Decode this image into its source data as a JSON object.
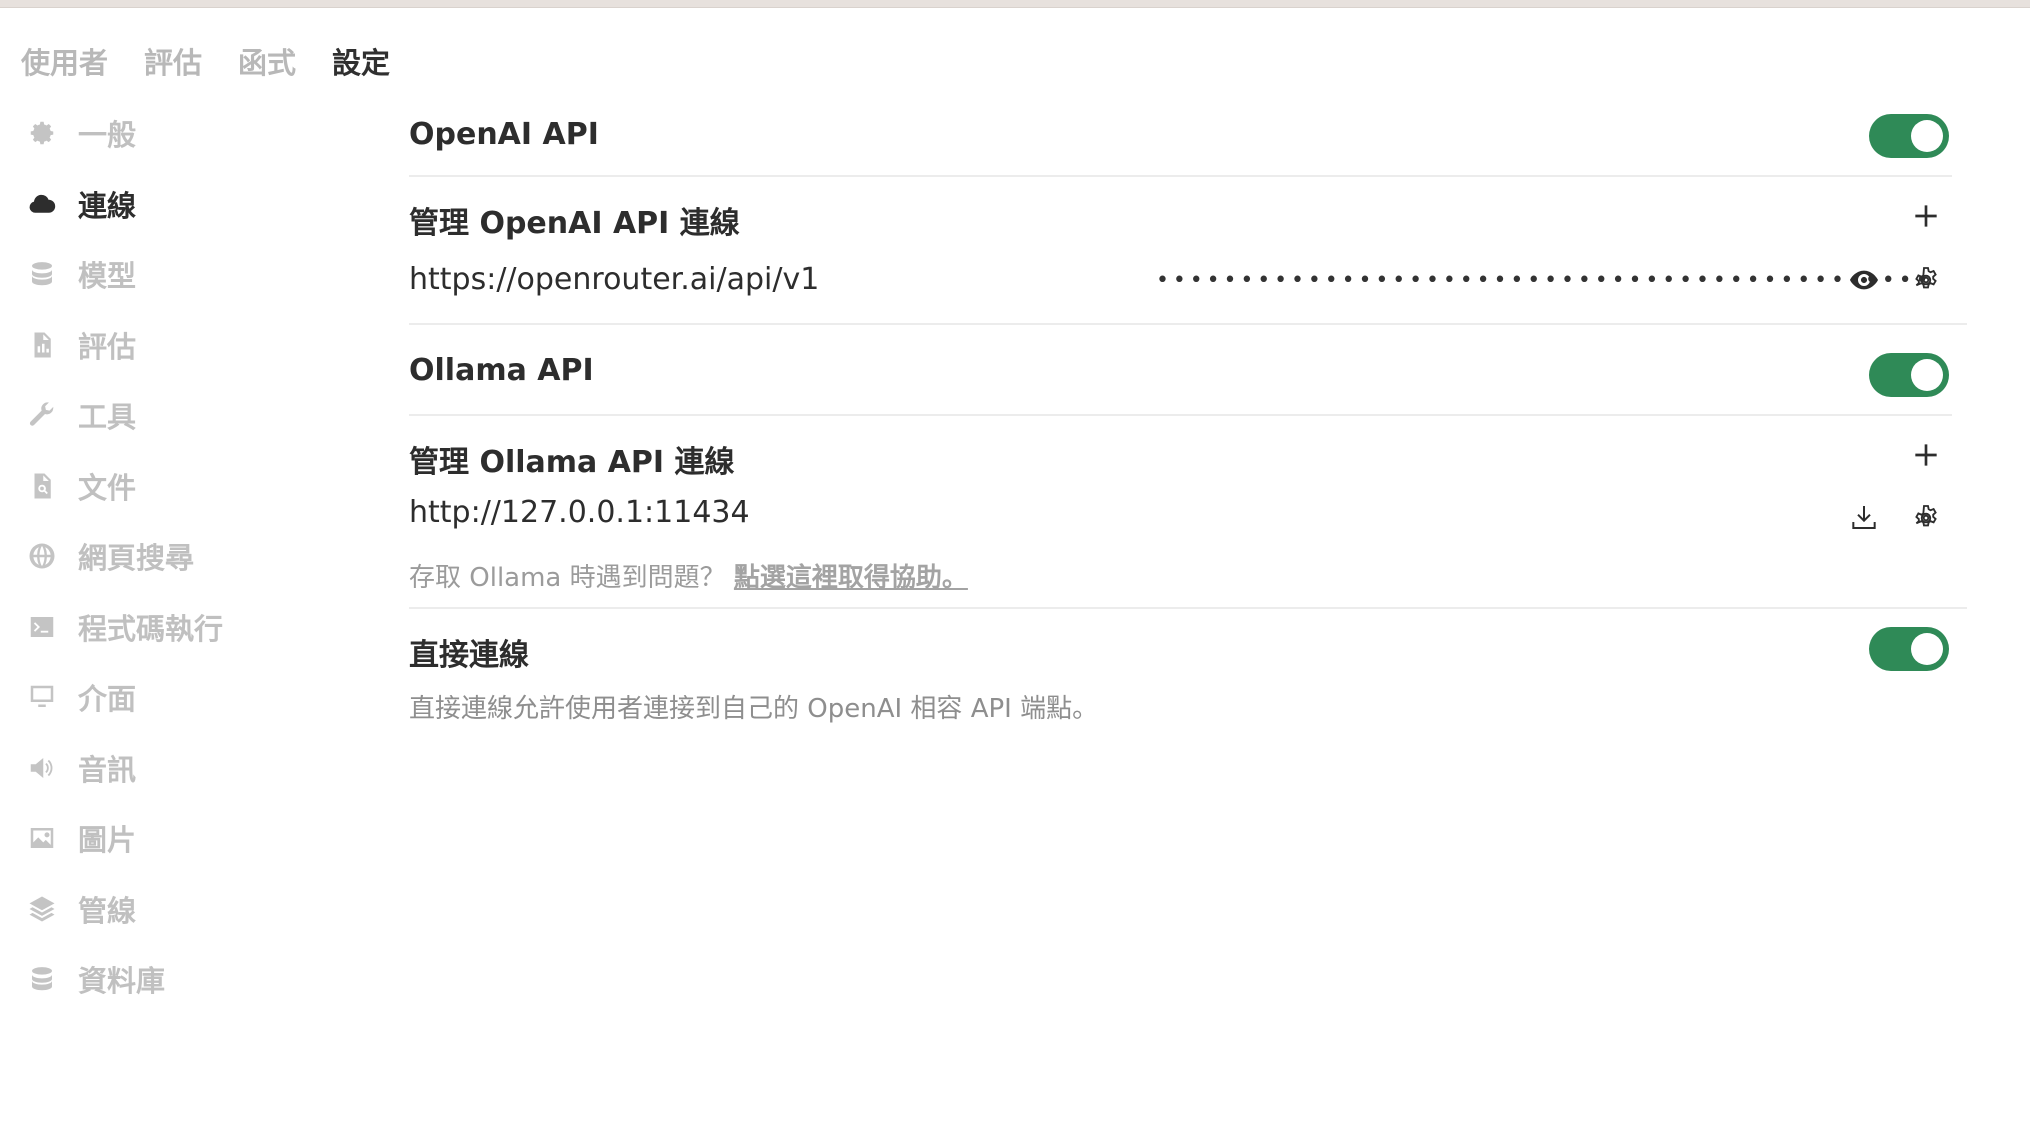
{
  "tabs": [
    {
      "label": "使用者"
    },
    {
      "label": "評估"
    },
    {
      "label": "函式"
    },
    {
      "label": "設定"
    }
  ],
  "sidebar": {
    "items": [
      {
        "label": "一般",
        "icon": "gear-icon"
      },
      {
        "label": "連線",
        "icon": "cloud-icon"
      },
      {
        "label": "模型",
        "icon": "database-icon"
      },
      {
        "label": "評估",
        "icon": "document-chart-icon"
      },
      {
        "label": "工具",
        "icon": "wrench-icon"
      },
      {
        "label": "文件",
        "icon": "document-search-icon"
      },
      {
        "label": "網頁搜尋",
        "icon": "globe-icon"
      },
      {
        "label": "程式碼執行",
        "icon": "terminal-icon"
      },
      {
        "label": "介面",
        "icon": "monitor-icon"
      },
      {
        "label": "音訊",
        "icon": "speaker-icon"
      },
      {
        "label": "圖片",
        "icon": "photo-icon"
      },
      {
        "label": "管線",
        "icon": "layers-icon"
      },
      {
        "label": "資料庫",
        "icon": "database-icon"
      }
    ]
  },
  "main": {
    "openai": {
      "title": "OpenAI API",
      "manage_title": "管理 OpenAI API 連線",
      "url": "https://openrouter.ai/api/v1",
      "masked_key": "••••••••••••••••••••••••••••••••••••••••••••••"
    },
    "ollama": {
      "title": "Ollama API",
      "manage_title": "管理 Ollama API 連線",
      "url": "http://127.0.0.1:11434",
      "hint": "存取 Ollama 時遇到問題？",
      "hint_link": "點選這裡取得協助。"
    },
    "direct": {
      "title": "直接連線",
      "description": "直接連線允許使用者連接到自己的 OpenAI 相容 API 端點。"
    }
  },
  "colors": {
    "toggle_on": "#2f8a57",
    "active_text": "#2d2d2d",
    "inactive_text": "#c0c0c0"
  }
}
